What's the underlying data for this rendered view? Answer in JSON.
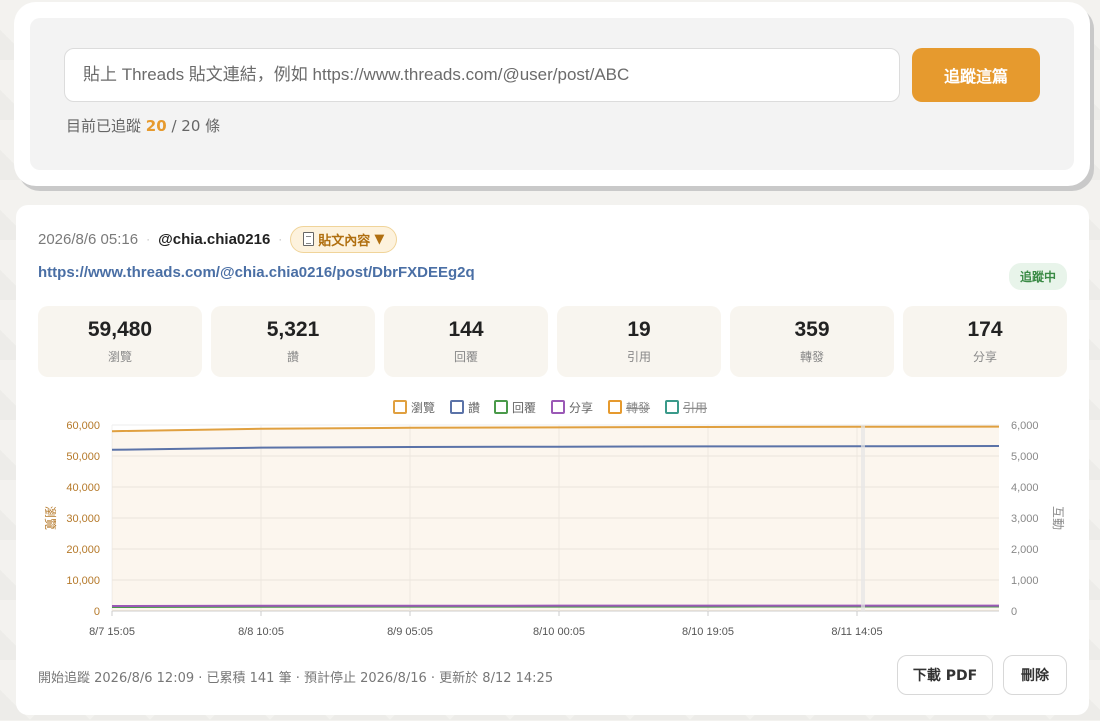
{
  "tracker": {
    "input_placeholder": "貼上 Threads 貼文連結，例如 https://www.threads.com/@user/post/ABC",
    "track_button": "追蹤這篇",
    "count_prefix": "目前已追蹤",
    "count_current": "20",
    "count_separator": "/",
    "count_max": "20",
    "count_unit": "條"
  },
  "post": {
    "date": "2026/8/6 05:16",
    "username": "@chia.chia0216",
    "content_toggle_label": "貼文內容",
    "content_toggle_arrow": "▼",
    "url": "https://www.threads.com/@chia.chia0216/post/DbrFXDEEg2q",
    "status": "追蹤中",
    "stats": [
      {
        "value": "59,480",
        "label": "瀏覽"
      },
      {
        "value": "5,321",
        "label": "讚"
      },
      {
        "value": "144",
        "label": "回覆"
      },
      {
        "value": "19",
        "label": "引用"
      },
      {
        "value": "359",
        "label": "轉發"
      },
      {
        "value": "174",
        "label": "分享"
      }
    ],
    "footer": "開始追蹤 2026/8/6 12:09 · 已累積 141 筆 · 預計停止 2026/8/16 · 更新於 8/12 14:25",
    "download_button": "下載 PDF",
    "delete_button": "刪除"
  },
  "colors": {
    "accent": "#e69a2e",
    "views": "#e0a040",
    "likes": "#5b73a8",
    "replies": "#4a9a4a",
    "shares": "#9b59b6",
    "reposts": "#e69a2e",
    "quotes": "#3a9a8a"
  },
  "chart_data": {
    "type": "line",
    "x": [
      "8/7 15:05",
      "8/8 10:05",
      "8/9 05:05",
      "8/10 00:05",
      "8/10 19:05",
      "8/11 14:05",
      "8/12 14:25"
    ],
    "x_tick_labels": [
      "8/7 15:05",
      "8/8 10:05",
      "8/9 05:05",
      "8/10 00:05",
      "8/10 19:05",
      "8/11 14:05"
    ],
    "left_axis": {
      "label": "瀏覽",
      "ylim": [
        0,
        60000
      ],
      "ticks": [
        "60,000",
        "50,000",
        "40,000",
        "30,000",
        "20,000",
        "10,000",
        "0"
      ]
    },
    "right_axis": {
      "label": "互動",
      "ylim": [
        0,
        6000
      ],
      "ticks": [
        "6,000",
        "5,000",
        "4,000",
        "3,000",
        "2,000",
        "1,000",
        "0"
      ]
    },
    "legend": [
      {
        "name": "瀏覽",
        "color": "#e0a040",
        "hidden": false
      },
      {
        "name": "讚",
        "color": "#5b73a8",
        "hidden": false
      },
      {
        "name": "回覆",
        "color": "#4a9a4a",
        "hidden": false
      },
      {
        "name": "分享",
        "color": "#9b59b6",
        "hidden": false
      },
      {
        "name": "轉發",
        "color": "#e69a2e",
        "hidden": true
      },
      {
        "name": "引用",
        "color": "#3a9a8a",
        "hidden": true
      }
    ],
    "legend_position": "top-center",
    "grid": true,
    "series": [
      {
        "name": "瀏覽",
        "axis": "left",
        "color": "#e0a040",
        "fill": true,
        "values": [
          58000,
          58800,
          59100,
          59250,
          59350,
          59420,
          59480
        ]
      },
      {
        "name": "讚",
        "axis": "right",
        "color": "#5b73a8",
        "fill": false,
        "values": [
          5200,
          5270,
          5290,
          5300,
          5310,
          5315,
          5321
        ]
      },
      {
        "name": "回覆",
        "axis": "right",
        "color": "#4a9a4a",
        "fill": false,
        "values": [
          130,
          138,
          140,
          142,
          143,
          144,
          144
        ]
      },
      {
        "name": "分享",
        "axis": "right",
        "color": "#9b59b6",
        "fill": false,
        "values": [
          160,
          168,
          170,
          172,
          173,
          174,
          174
        ]
      }
    ]
  }
}
